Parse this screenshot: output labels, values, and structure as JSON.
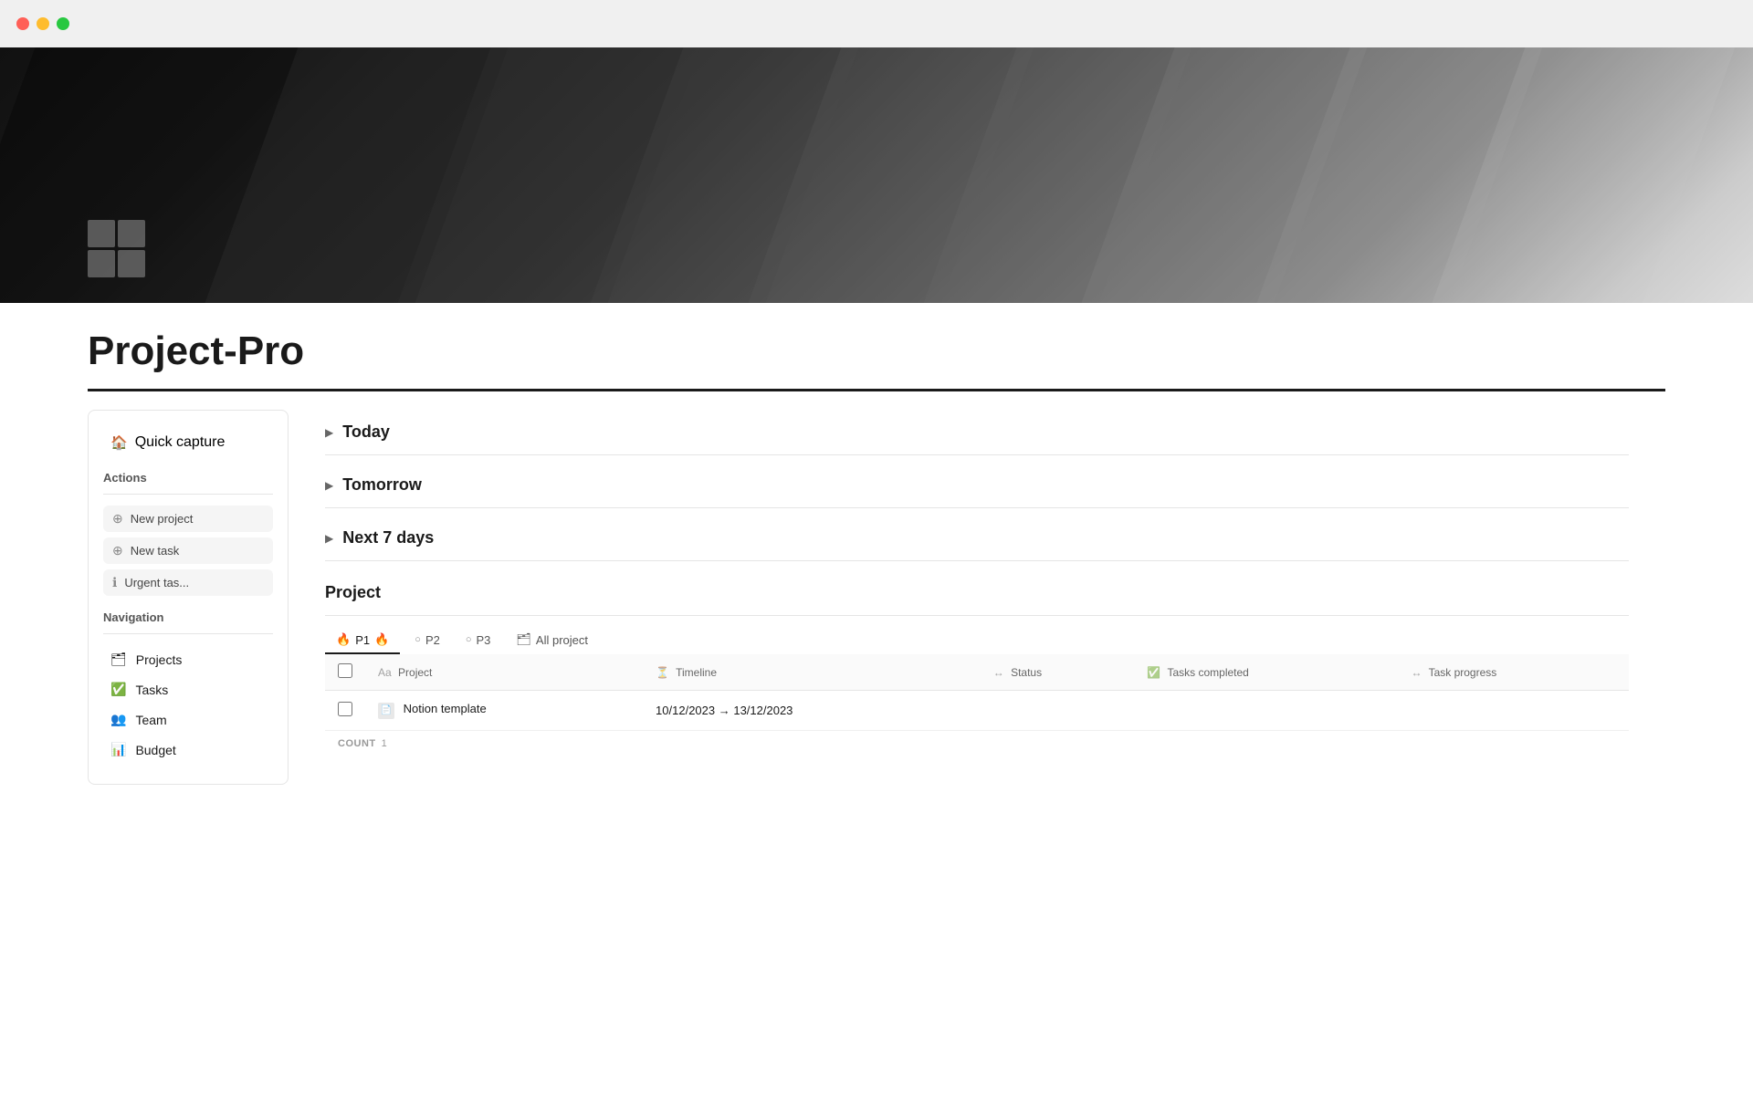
{
  "titlebar": {
    "traffic_lights": [
      "red",
      "yellow",
      "green"
    ]
  },
  "hero": {
    "icon_squares": 4
  },
  "page": {
    "title": "Project-Pro"
  },
  "sidebar": {
    "quick_capture_label": "Quick capture",
    "actions_label": "Actions",
    "actions": [
      {
        "id": "new-project",
        "icon": "➕",
        "label": "New project"
      },
      {
        "id": "new-task",
        "icon": "➕",
        "label": "New task"
      },
      {
        "id": "urgent-task",
        "icon": "ℹ️",
        "label": "Urgent tas..."
      }
    ],
    "navigation_label": "Navigation",
    "nav_items": [
      {
        "id": "projects",
        "icon": "🗂",
        "label": "Projects"
      },
      {
        "id": "tasks",
        "icon": "✅",
        "label": "Tasks"
      },
      {
        "id": "team",
        "icon": "👥",
        "label": "Team"
      },
      {
        "id": "budget",
        "icon": "📊",
        "label": "Budget"
      }
    ]
  },
  "content": {
    "sections": [
      {
        "id": "today",
        "label": "Today"
      },
      {
        "id": "tomorrow",
        "label": "Tomorrow"
      },
      {
        "id": "next7days",
        "label": "Next 7 days"
      }
    ],
    "project_section_title": "Project",
    "tabs": [
      {
        "id": "p1",
        "label": "P1",
        "icon": "🔥",
        "active": true
      },
      {
        "id": "p2",
        "label": "P2",
        "icon": "○",
        "active": false
      },
      {
        "id": "p3",
        "label": "P3",
        "icon": "○",
        "active": false
      },
      {
        "id": "allproject",
        "label": "All project",
        "icon": "🗂",
        "active": false
      }
    ],
    "table": {
      "columns": [
        {
          "id": "checkbox",
          "label": ""
        },
        {
          "id": "project",
          "label": "Project",
          "icon": "Aa"
        },
        {
          "id": "timeline",
          "label": "Timeline",
          "icon": "⏳"
        },
        {
          "id": "status",
          "label": "Status",
          "icon": "✅"
        },
        {
          "id": "tasks_completed",
          "label": "Tasks completed",
          "icon": "✅"
        },
        {
          "id": "task_progress",
          "label": "Task progress",
          "icon": "↔"
        }
      ],
      "rows": [
        {
          "id": "notion-template",
          "project": "Notion template",
          "timeline": "10/12/2023 → 13/12/2023",
          "status": "",
          "tasks_completed": "",
          "task_progress": ""
        }
      ],
      "count_label": "COUNT",
      "count_value": "1"
    }
  }
}
